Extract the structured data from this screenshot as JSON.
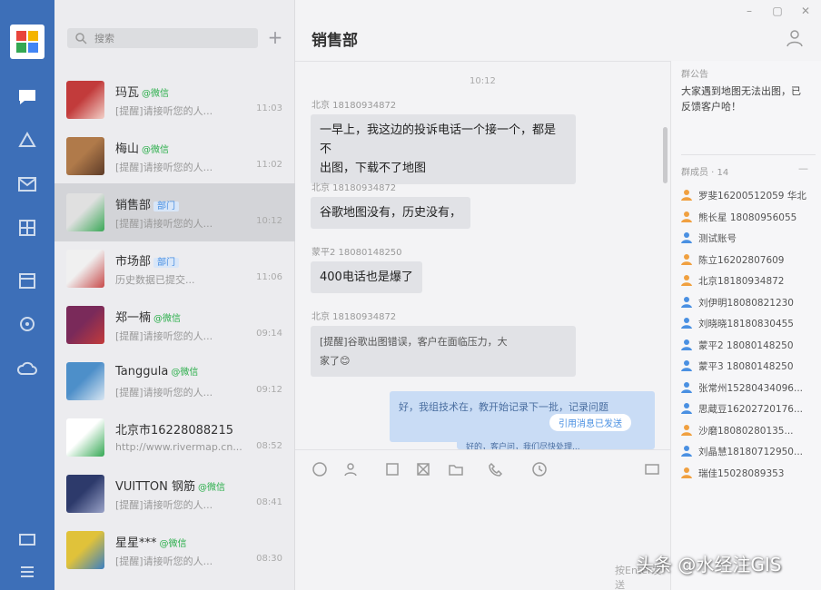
{
  "app": {
    "logo_name": "app-logo"
  },
  "rail": {
    "items": [
      "chat-icon",
      "contacts-icon",
      "mail-icon",
      "apps-icon",
      "calendar-icon",
      "settings-icon",
      "cloud-icon",
      "screen-icon",
      "menu-icon"
    ]
  },
  "search": {
    "placeholder": "搜索",
    "add_label": "+"
  },
  "conversations": [
    {
      "name": "玛瓦",
      "tag": "@微信",
      "tag_type": "wechat",
      "preview": "[提醒]请接听您的人...",
      "time": "11:03"
    },
    {
      "name": "梅山",
      "tag": "@微信",
      "tag_type": "wechat",
      "preview": "[提醒]请接听您的人...",
      "time": "11:02"
    },
    {
      "name": "销售部",
      "tag": "部门",
      "tag_type": "blue",
      "preview": "[提醒]请接听您的人...",
      "time": "10:12"
    },
    {
      "name": "市场部",
      "tag": "部门",
      "tag_type": "blue",
      "preview": "历史数据已提交...",
      "time": "11:06"
    },
    {
      "name": "郑一楠",
      "tag": "@微信",
      "tag_type": "wechat",
      "preview": "[提醒]请接听您的人...",
      "time": "09:14"
    },
    {
      "name": "Tanggula",
      "tag": "@微信",
      "tag_type": "wechat",
      "preview": "[提醒]请接听您的人...",
      "time": "09:12"
    },
    {
      "name": "北京市16228088215",
      "tag": "",
      "tag_type": "",
      "preview": "http://www.rivermap.cn...",
      "time": "08:52"
    },
    {
      "name": "VUITTON 钢筋",
      "tag": "@微信",
      "tag_type": "wechat",
      "preview": "[提醒]请接听您的人...",
      "time": "08:41"
    },
    {
      "name": "星星***",
      "tag": "@微信",
      "tag_type": "wechat",
      "preview": "[提醒]请接听您的人...",
      "time": "08:30"
    }
  ],
  "chat": {
    "title": "销售部",
    "timestamp": "10:12",
    "messages": [
      {
        "sender": "北京 18180934872",
        "text_lines": [
          "一早上，我这边的投诉电话一个接一个，都是不",
          "出图，下载不了地图"
        ]
      },
      {
        "sender": "北京 18180934872",
        "text_lines": [
          "谷歌地图没有，历史没有，"
        ]
      },
      {
        "sender": "蒙平2 18080148250",
        "text_lines": [
          "400电话也是爆了"
        ]
      },
      {
        "sender": "北京 18180934872",
        "text_lines": [
          "[提醒]谷歌出图错误，客户在面临压力，大",
          "家了😊"
        ]
      }
    ],
    "self_messages": [
      {
        "text": "好，我组技术在，教开始记录下一批，记录问题",
        "chip": "引用消息已发送"
      },
      {
        "text": "好的，客户问，我们尽快处理..."
      }
    ],
    "send_hint": "按Enter发送"
  },
  "toolbar": {
    "icons": [
      "emoji-icon",
      "mention-icon",
      "file-icon",
      "screenshot-icon",
      "folder-icon",
      "phone-icon",
      "history-icon",
      "expand-icon"
    ]
  },
  "window_controls": {
    "minimize": "–",
    "maximize": "▢",
    "close": "✕"
  },
  "panel": {
    "notice_label": "群公告",
    "notice_text": "大家遇到地图无法出图，已反馈客户哈！",
    "members_label": "群成员 · 14",
    "collapse_label": "—",
    "members": [
      {
        "name": "罗斐16200512059 华北",
        "color": "orange"
      },
      {
        "name": "熊长星 18080956055",
        "color": "orange"
      },
      {
        "name": "测试账号",
        "color": "blue"
      },
      {
        "name": "陈立16202807609",
        "color": "orange"
      },
      {
        "name": "北京18180934872",
        "color": "orange"
      },
      {
        "name": "刘伊明18080821230",
        "color": "blue"
      },
      {
        "name": "刘晓晓18180830455",
        "color": "blue"
      },
      {
        "name": "蒙平2 18080148250",
        "color": "blue"
      },
      {
        "name": "蒙平3 18080148250",
        "color": "blue"
      },
      {
        "name": "张常州15280434096...",
        "color": "blue"
      },
      {
        "name": "思蔵豆16202720176...",
        "color": "blue"
      },
      {
        "name": "沙磨18080280135...",
        "color": "orange"
      },
      {
        "name": "刘晶慧18180712950...",
        "color": "blue"
      },
      {
        "name": "瑞佳15028089353",
        "color": "orange"
      }
    ]
  },
  "watermark": "头条 @水经注GIS",
  "colors": {
    "rail": "#3d6fb8",
    "wechat_green": "#2aae4a",
    "link_blue": "#4a90e2",
    "self_bubble": "#c9dcf5"
  }
}
